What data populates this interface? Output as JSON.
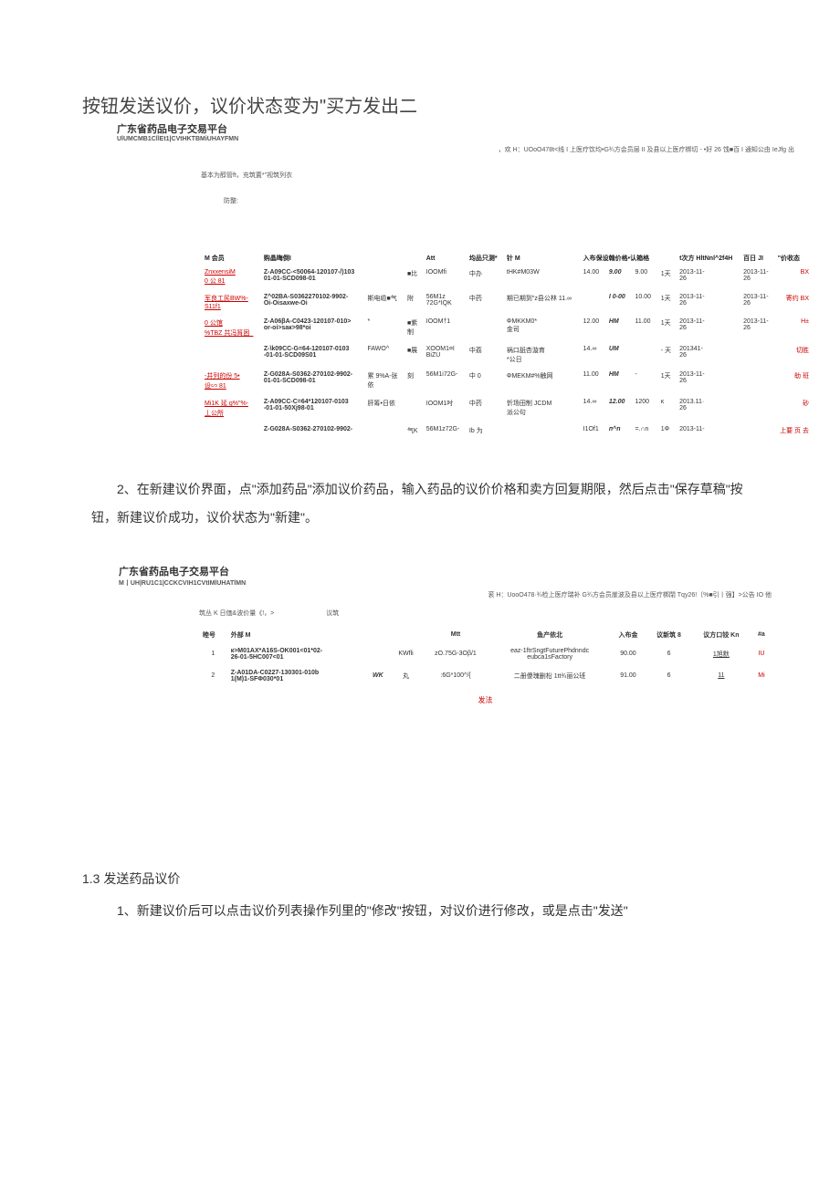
{
  "page_title": "按钮发送议价，议价状态变为\"买方发出二",
  "platform": {
    "name": "广东省药品电子交易平台",
    "sub": "UlUMCMB1CllEt1|CVtHKTBMiUHAYFMN"
  },
  "breadcrumbs1": "，欢 H：UOoO478t<线 I 上医疗饮均•G¾方会员层 II 及县以上医疗梆切 - •好 26 饯■百 I 通知公由 IeJfg 出",
  "filter_label1": "基本为醇管ft，充筑置*\"视筑列衣",
  "filter_label2": "防整:",
  "table1": {
    "headers": [
      "M 会员",
      "购晶晦倒I",
      "",
      "",
      "Att",
      "均品只测*",
      "针 M",
      "入布保设翰价格•认箱格",
      "",
      "",
      "",
      "t次方 HltNnl^2f4H",
      "百日 JI",
      "\"价收态"
    ],
    "rows": [
      {
        "left": [
          "ZnxxensiM",
          "0 公 81"
        ],
        "code": [
          "Z-A09CC-<50064-120107-/)103",
          "01-01-SCD098-01"
        ],
        "c3": "",
        "c4": "■比",
        "c5": "IOOMfi\n</A",
        "c6": "中办",
        "c7": "tHK#M03W",
        "n1": "14.00",
        "n2": "9.00",
        "n3": "9.00",
        "n4": "1天",
        "d1": "2013-11-\n26",
        "d2": "2013-11-\n26",
        "action": "BX"
      },
      {
        "left": [
          "军良工民BW%-",
          "S11f1"
        ],
        "code": [
          "Z^02BA-S0362270102-9902-",
          "Oi-Oisaxwe-Oi"
        ],
        "c3": "斯电缆■气",
        "c4": "附",
        "c5": "56M1z\n72G*IQK",
        "c6": "中药",
        "c7": "期已期到\"z县公林 11.∞",
        "n1": "",
        "n2": "I 0-00",
        "n3": "10.00",
        "n4": "1天",
        "d1": "2013-11-\n26",
        "d2": "2013-11-\n26",
        "action": "寄约 BX"
      },
      {
        "left": [
          "0 公馆",
          "%TBZ 共冯筲困_"
        ],
        "code": [
          "Z-A06βA-C0423-120107-010>",
          "or-oi>saк>98*оi"
        ],
        "c3": "*",
        "c4": "■紫\n制",
        "c5": "IOOM†1",
        "c6": "",
        "c7": "ΦMKKM0*\n金司",
        "n1": "12.00",
        "n2": "HM",
        "n3": "11.00",
        "n4": "1天",
        "d1": "2013-11-\n26",
        "d2": "2013-11-\n26",
        "action": "H±"
      },
      {
        "left": [],
        "code": [
          "Z-\\k09CC-G=64-120107-0103",
          "-01-01-SCD09S01"
        ],
        "c3": "FAWO^",
        "c4": "■展",
        "c5": "XOOM1¤I\nBiZU",
        "c6": "中荔",
        "c7": "祸口舐杏漩育\n*公日",
        "n1": "14.∞",
        "n2": "UM",
        "n3": "",
        "n4": "- 天",
        "d1": "201341-\n26",
        "d2": "",
        "action": "切胜"
      },
      {
        "left": [
          "-井列的份 5•",
          "设∽ 81"
        ],
        "code": [
          "Z-G028A-S0362-270102-9902-",
          "01-01-SCD098-01"
        ],
        "c3": "累 9%A-张\n依",
        "c4": "刻",
        "c5": "56M1i72G-",
        "c6": "中 0",
        "c7": "ΦMEKM#%触网",
        "n1": "11.00",
        "n2": "HM",
        "n3": "-",
        "n4": "1天",
        "d1": "2013-11-\n26",
        "d2": "",
        "action": "劺    班"
      },
      {
        "left": [
          "Mi1K 延 g%\"%-",
          "丄公所"
        ],
        "code": [
          "Z-A09CC-C=64*120107-0103",
          "-01-01-50Xj98-01"
        ],
        "c3": "肝筹•日依",
        "c4": "",
        "c5": "IOOM1吋",
        "c6": "中药",
        "c7": "忻场田制 JCDM\n派公句",
        "n1": "14.∞",
        "n2": "12.00",
        "n3": "1200",
        "n4": "κ",
        "d1": "2013.11·\n26",
        "d2": "",
        "action": "砂"
      },
      {
        "left": [],
        "code": [
          "Z-G028A-S0362-270102-9902-"
        ],
        "c3": "",
        "c4": "气K",
        "c5": "56M1z72G-",
        "c6": "Ib 为",
        "c7": "",
        "n1": "I1Of1",
        "n2": "п^n",
        "n3": "=.∩n",
        "n4": "1Φ",
        "d1": "2013-11-",
        "d2": "",
        "action": "上要   页 去"
      }
    ]
  },
  "step2_text": "2、在新建议价界面，点\"添加药品\"添加议价药品，输入药品的议价价格和卖方回复期限，然后点击\"保存草稿\"按钮，新建议价成功，议价状态为\"新建\"。",
  "platform2": {
    "name": "广东省药品电子交易平台",
    "sub": "M丨UH|RU1C1|CCKCVIH1CVtIMlUHATlMN"
  },
  "breadcrumbs2": "衮 H：UooO478·¾检上医疗瑞补 G¾方会员崖波及县以上医疗梆閉 Tqy26!〔%■引丨强】>公告 IO 他",
  "filter2_left": "筑丛 K 日価&波价量《!，>",
  "filter2_right": "议筑",
  "table2": {
    "headers": [
      "睦号",
      "外部 M",
      "",
      "",
      "Mtt",
      "鱼产依北",
      "入布金",
      "议新筑 8",
      "议方口铰 Kn",
      "#a"
    ],
    "rows": [
      {
        "no": "1",
        "code": "к>M01AX*A16S-OK001<01*02-\n26-01-5HC007<01",
        "c3": "",
        "c4": "KWfli",
        "c5": "zO.75G-3Oβ/1",
        "c6": "eaz-1ftrSngtFuturePhdnndc\neubca1sFactory",
        "n1": "90.00",
        "n2": "6",
        "n3": "1旭默",
        "action": "IU"
      },
      {
        "no": "2",
        "code": "Z-A01DA-C0227-130301-010b\n1(M)1-SFΦ030*01",
        "c3": "WK",
        "c4": "丸",
        "c5": ":6G*100^/{",
        "c6": "二册傻瑰删柗 1tt¾丽公班",
        "n1": "91.00",
        "n2": "6",
        "n3": "11",
        "action": "Mi"
      }
    ],
    "footer": "发法"
  },
  "section_13_title": "1.3 发送药品议价",
  "section_13_step": "1、新建议价后可以点击议价列表操作列里的\"修改\"按钮，对议价进行修改，或是点击\"发送\""
}
